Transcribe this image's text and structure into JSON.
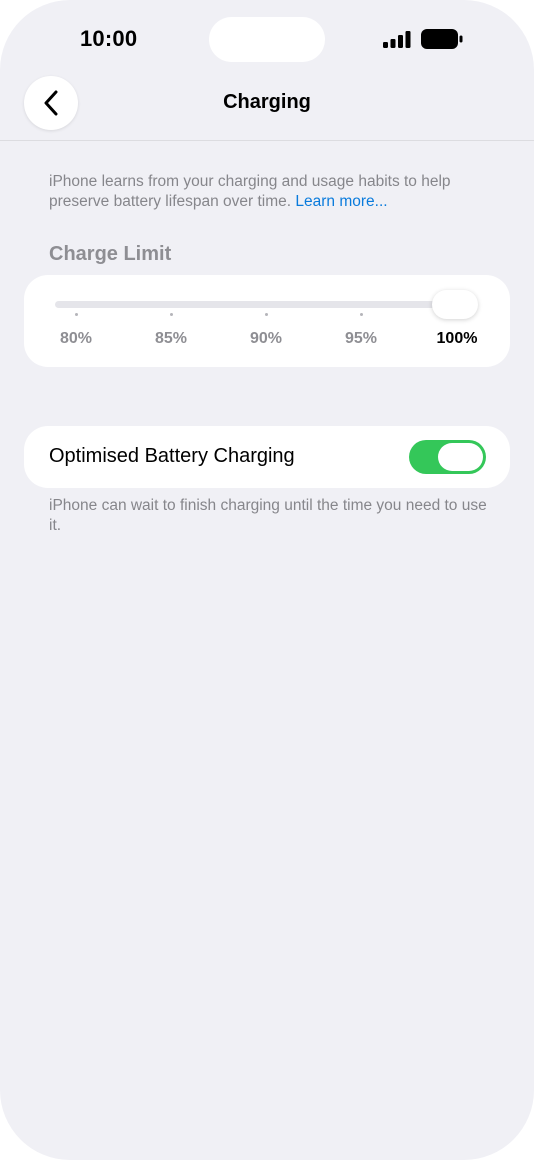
{
  "status_bar": {
    "time": "10:00"
  },
  "nav": {
    "title": "Charging",
    "back_icon": "chevron-left-icon"
  },
  "intro": {
    "text": "iPhone learns from your charging and usage habits to help preserve battery lifespan over time. ",
    "link": "Learn more..."
  },
  "charge_limit": {
    "title": "Charge Limit",
    "ticks": [
      "80%",
      "85%",
      "90%",
      "95%",
      "100%"
    ],
    "selected": "100%"
  },
  "optimised": {
    "label": "Optimised Battery Charging",
    "enabled": true,
    "footer": "iPhone can wait to finish charging until the time you need to use it."
  },
  "colors": {
    "accent": "#0a7bdc",
    "toggle_on": "#34c759",
    "background": "#f0f0f5"
  }
}
